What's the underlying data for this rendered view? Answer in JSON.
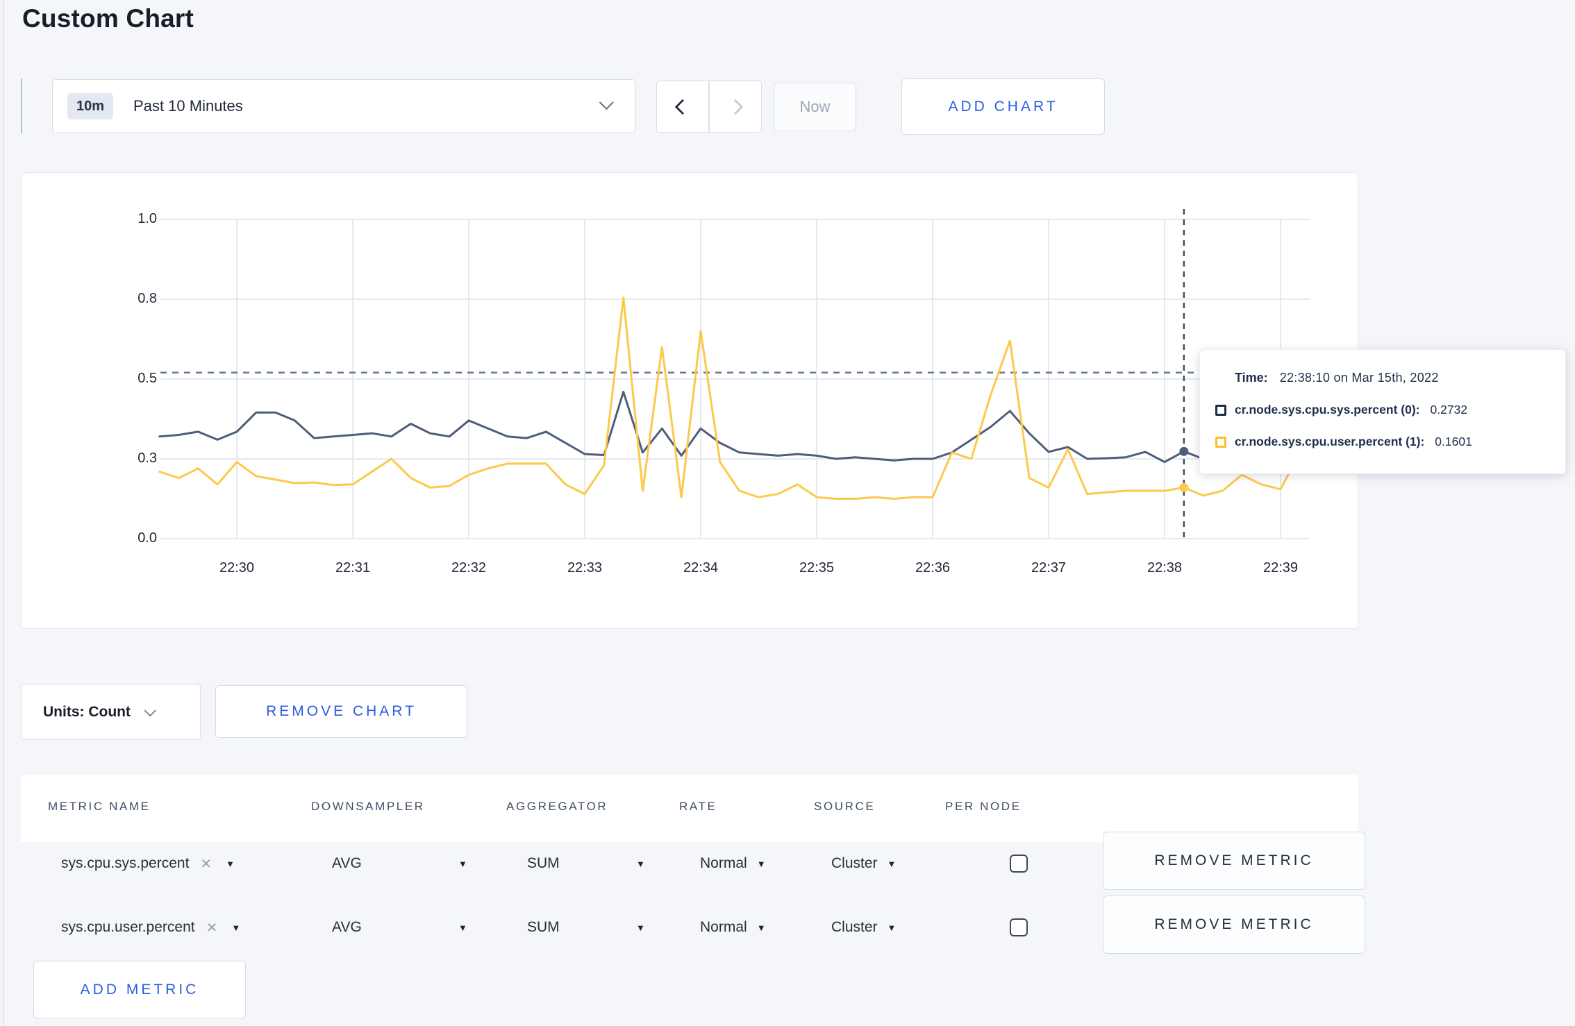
{
  "page": {
    "title": "Custom Chart",
    "background": "#f5f6f9",
    "accent_blue": "#2b5de0"
  },
  "icons": {
    "close_glyph": "✕",
    "caret_glyph": "▼"
  },
  "toolbar": {
    "time_picker": {
      "badge": "10m",
      "label": "Past 10 Minutes"
    },
    "now_label": "Now",
    "add_chart_label": "ADD CHART"
  },
  "chart_controls": {
    "units_label": "Units: Count",
    "remove_chart_label": "REMOVE CHART"
  },
  "tooltip": {
    "time_label": "Time:",
    "time_value": "22:38:10 on Mar 15th, 2022",
    "rows": [
      {
        "name": "cr.node.sys.cpu.sys.percent (0):",
        "value": "0.2732",
        "swatch_color": "#1d2c4d"
      },
      {
        "name": "cr.node.sys.cpu.user.percent (1):",
        "value": "0.1601",
        "swatch_color": "#fcbe1e"
      }
    ]
  },
  "chart_data": {
    "type": "line",
    "title": "",
    "xlabel": "",
    "ylabel": "",
    "ylim": [
      0,
      1
    ],
    "grid": true,
    "legend_position": "tooltip-overlay",
    "x_ticks": [
      "22:30",
      "22:31",
      "22:32",
      "22:33",
      "22:34",
      "22:35",
      "22:36",
      "22:37",
      "22:38",
      "22:39"
    ],
    "y_tick_labels": [
      "1.0",
      "0.8",
      "0.5",
      "0.3",
      "0.0"
    ],
    "y_tick_values": [
      1.0,
      0.75,
      0.5,
      0.25,
      0.0
    ],
    "x_range": "22:29:20 to 22:39:10, one point every 10 seconds",
    "x_offsets_seconds": [
      -40,
      -30,
      -20,
      -10,
      0,
      10,
      20,
      30,
      40,
      50,
      60,
      70,
      80,
      90,
      100,
      110,
      120,
      130,
      140,
      150,
      160,
      170,
      180,
      190,
      200,
      210,
      220,
      230,
      240,
      250,
      260,
      270,
      280,
      290,
      300,
      310,
      320,
      330,
      340,
      350,
      360,
      370,
      380,
      390,
      400,
      410,
      420,
      430,
      440,
      450,
      460,
      470,
      480,
      490,
      500,
      510,
      520,
      530,
      540,
      550
    ],
    "reference_line_y": 0.52,
    "crosshair": {
      "time": "22:38:10",
      "x_offset_seconds": 490,
      "point_values": [
        0.2732,
        0.1601
      ]
    },
    "series": [
      {
        "name": "cr.node.sys.cpu.sys.percent (0)",
        "color": "#4e5d7a",
        "values": [
          0.32,
          0.325,
          0.335,
          0.31,
          0.335,
          0.395,
          0.395,
          0.37,
          0.315,
          0.32,
          0.325,
          0.33,
          0.32,
          0.36,
          0.33,
          0.32,
          0.37,
          0.345,
          0.32,
          0.315,
          0.335,
          0.3,
          0.265,
          0.262,
          0.46,
          0.27,
          0.345,
          0.26,
          0.345,
          0.3,
          0.27,
          0.265,
          0.26,
          0.265,
          0.26,
          0.25,
          0.255,
          0.25,
          0.245,
          0.25,
          0.25,
          0.27,
          0.31,
          0.35,
          0.4,
          0.33,
          0.272,
          0.287,
          0.25,
          0.252,
          0.255,
          0.272,
          0.24,
          0.2732,
          0.25,
          0.268,
          0.29,
          0.276,
          0.27,
          0.285
        ]
      },
      {
        "name": "cr.node.sys.cpu.user.percent (1)",
        "color": "#fcc94b",
        "values": [
          0.21,
          0.19,
          0.22,
          0.17,
          0.24,
          0.196,
          0.185,
          0.174,
          0.176,
          0.168,
          0.17,
          0.21,
          0.25,
          0.19,
          0.16,
          0.165,
          0.2,
          0.22,
          0.235,
          0.235,
          0.235,
          0.17,
          0.14,
          0.23,
          0.755,
          0.15,
          0.6,
          0.13,
          0.65,
          0.24,
          0.15,
          0.13,
          0.14,
          0.17,
          0.13,
          0.125,
          0.125,
          0.13,
          0.125,
          0.13,
          0.13,
          0.27,
          0.25,
          0.45,
          0.62,
          0.19,
          0.16,
          0.28,
          0.14,
          0.145,
          0.15,
          0.15,
          0.15,
          0.1601,
          0.135,
          0.15,
          0.2,
          0.17,
          0.155,
          0.27
        ]
      }
    ]
  },
  "metrics_table": {
    "headers": [
      "METRIC NAME",
      "DOWNSAMPLER",
      "AGGREGATOR",
      "RATE",
      "SOURCE",
      "PER NODE"
    ],
    "rows": [
      {
        "metric": "sys.cpu.sys.percent",
        "downsampler": "AVG",
        "aggregator": "SUM",
        "rate": "Normal",
        "source": "Cluster",
        "per_node_checked": false,
        "remove_label": "REMOVE METRIC"
      },
      {
        "metric": "sys.cpu.user.percent",
        "downsampler": "AVG",
        "aggregator": "SUM",
        "rate": "Normal",
        "source": "Cluster",
        "per_node_checked": false,
        "remove_label": "REMOVE METRIC"
      }
    ],
    "add_metric_label": "ADD METRIC"
  }
}
